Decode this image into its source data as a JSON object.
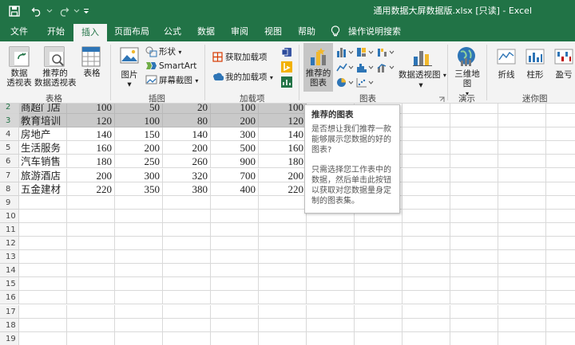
{
  "window": {
    "title": "通用数据大屏数据版.xlsx  [只读]  -  Excel"
  },
  "tabs": [
    "文件",
    "开始",
    "插入",
    "页面布局",
    "公式",
    "数据",
    "审阅",
    "视图",
    "帮助",
    "操作说明搜索"
  ],
  "active_tab": "插入",
  "ribbon": {
    "pivot_table": "数据\n透视表",
    "recommended_pivot": "推荐的\n数据透视表",
    "table": "表格",
    "group_tables": "表格",
    "pictures": "图片",
    "shapes": "形状",
    "smartart": "SmartArt",
    "screenshot": "屏幕截图",
    "group_illustrations": "插图",
    "get_addins": "获取加载项",
    "my_addins": "我的加载项",
    "group_addins": "加载项",
    "recommended_charts": "推荐的\n图表",
    "pivot_chart": "数据透视图",
    "group_charts": "图表",
    "map3d": "三维地\n图",
    "group_tours": "演示",
    "line": "折线",
    "column": "柱形",
    "winloss": "盈亏",
    "group_sparklines": "迷你图"
  },
  "tooltip": {
    "title": "推荐的图表",
    "para1": "是否想让我们推荐一款能够展示您数据的好的图表?",
    "para2": "只需选择您工作表中的数据，然后单击此按钮以获取对您数据量身定制的图表集。"
  },
  "sheet": {
    "rows": [
      {
        "num": "2",
        "cells": [
          "商超门店",
          "100",
          "50",
          "20",
          "100",
          "100"
        ],
        "selected": true
      },
      {
        "num": "3",
        "cells": [
          "教育培训",
          "120",
          "100",
          "80",
          "200",
          "120"
        ],
        "selected": true
      },
      {
        "num": "4",
        "cells": [
          "房地产",
          "140",
          "150",
          "140",
          "300",
          "140"
        ]
      },
      {
        "num": "5",
        "cells": [
          "生活服务",
          "160",
          "200",
          "200",
          "500",
          "160"
        ]
      },
      {
        "num": "6",
        "cells": [
          "汽车销售",
          "180",
          "250",
          "260",
          "900",
          "180"
        ]
      },
      {
        "num": "7",
        "cells": [
          "旅游酒店",
          "200",
          "300",
          "320",
          "700",
          "200"
        ]
      },
      {
        "num": "8",
        "cells": [
          "五金建材",
          "220",
          "350",
          "380",
          "400",
          "220"
        ]
      },
      {
        "num": "9",
        "cells": [
          "",
          "",
          "",
          "",
          "",
          ""
        ]
      },
      {
        "num": "10",
        "cells": [
          "",
          "",
          "",
          "",
          "",
          ""
        ]
      },
      {
        "num": "11",
        "cells": [
          "",
          "",
          "",
          "",
          "",
          ""
        ]
      },
      {
        "num": "12",
        "cells": [
          "",
          "",
          "",
          "",
          "",
          ""
        ]
      },
      {
        "num": "13",
        "cells": [
          "",
          "",
          "",
          "",
          "",
          ""
        ]
      },
      {
        "num": "14",
        "cells": [
          "",
          "",
          "",
          "",
          "",
          ""
        ]
      },
      {
        "num": "15",
        "cells": [
          "",
          "",
          "",
          "",
          "",
          ""
        ]
      },
      {
        "num": "16",
        "cells": [
          "",
          "",
          "",
          "",
          "",
          ""
        ]
      },
      {
        "num": "17",
        "cells": [
          "",
          "",
          "",
          "",
          "",
          ""
        ]
      },
      {
        "num": "18",
        "cells": [
          "",
          "",
          "",
          "",
          "",
          ""
        ]
      },
      {
        "num": "19",
        "cells": [
          "",
          "",
          "",
          "",
          "",
          ""
        ]
      }
    ]
  },
  "colors": {
    "brand": "#217346",
    "selection": "#c9c9c9"
  }
}
